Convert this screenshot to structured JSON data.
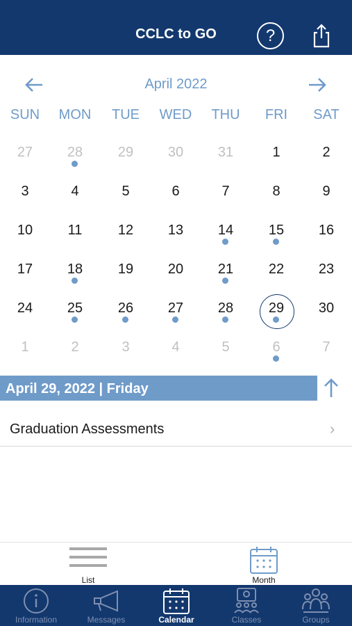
{
  "header": {
    "title": "CCLC to GO",
    "help_icon_glyph": "?"
  },
  "calendar": {
    "month_label": "April 2022",
    "weekdays": [
      "SUN",
      "MON",
      "TUE",
      "WED",
      "THU",
      "FRI",
      "SAT"
    ],
    "weeks": [
      [
        {
          "d": "27",
          "o": true,
          "e": false
        },
        {
          "d": "28",
          "o": true,
          "e": true
        },
        {
          "d": "29",
          "o": true,
          "e": false
        },
        {
          "d": "30",
          "o": true,
          "e": false
        },
        {
          "d": "31",
          "o": true,
          "e": false
        },
        {
          "d": "1",
          "o": false,
          "e": false
        },
        {
          "d": "2",
          "o": false,
          "e": false
        }
      ],
      [
        {
          "d": "3",
          "o": false,
          "e": false
        },
        {
          "d": "4",
          "o": false,
          "e": false
        },
        {
          "d": "5",
          "o": false,
          "e": false
        },
        {
          "d": "6",
          "o": false,
          "e": false
        },
        {
          "d": "7",
          "o": false,
          "e": false
        },
        {
          "d": "8",
          "o": false,
          "e": false
        },
        {
          "d": "9",
          "o": false,
          "e": false
        }
      ],
      [
        {
          "d": "10",
          "o": false,
          "e": false
        },
        {
          "d": "11",
          "o": false,
          "e": false
        },
        {
          "d": "12",
          "o": false,
          "e": false
        },
        {
          "d": "13",
          "o": false,
          "e": false
        },
        {
          "d": "14",
          "o": false,
          "e": true
        },
        {
          "d": "15",
          "o": false,
          "e": true
        },
        {
          "d": "16",
          "o": false,
          "e": false
        }
      ],
      [
        {
          "d": "17",
          "o": false,
          "e": false
        },
        {
          "d": "18",
          "o": false,
          "e": true
        },
        {
          "d": "19",
          "o": false,
          "e": false
        },
        {
          "d": "20",
          "o": false,
          "e": false
        },
        {
          "d": "21",
          "o": false,
          "e": true
        },
        {
          "d": "22",
          "o": false,
          "e": false
        },
        {
          "d": "23",
          "o": false,
          "e": false
        }
      ],
      [
        {
          "d": "24",
          "o": false,
          "e": false
        },
        {
          "d": "25",
          "o": false,
          "e": true
        },
        {
          "d": "26",
          "o": false,
          "e": true
        },
        {
          "d": "27",
          "o": false,
          "e": true
        },
        {
          "d": "28",
          "o": false,
          "e": true
        },
        {
          "d": "29",
          "o": false,
          "e": true,
          "s": true
        },
        {
          "d": "30",
          "o": false,
          "e": false
        }
      ],
      [
        {
          "d": "1",
          "o": true,
          "e": false
        },
        {
          "d": "2",
          "o": true,
          "e": false
        },
        {
          "d": "3",
          "o": true,
          "e": false
        },
        {
          "d": "4",
          "o": true,
          "e": false
        },
        {
          "d": "5",
          "o": true,
          "e": false
        },
        {
          "d": "6",
          "o": true,
          "e": true
        },
        {
          "d": "7",
          "o": true,
          "e": false
        }
      ]
    ]
  },
  "selected_day": {
    "label": "April 29, 2022 | Friday"
  },
  "events": [
    {
      "title": "Graduation Assessments",
      "chevron": "›"
    }
  ],
  "view_switch": {
    "list_label": "List",
    "month_label": "Month"
  },
  "tabs": [
    {
      "label": "Information",
      "icon": "info-icon",
      "active": false
    },
    {
      "label": "Messages",
      "icon": "megaphone-icon",
      "active": false
    },
    {
      "label": "Calendar",
      "icon": "calendar-icon",
      "active": true
    },
    {
      "label": "Classes",
      "icon": "classes-icon",
      "active": false
    },
    {
      "label": "Groups",
      "icon": "groups-icon",
      "active": false
    }
  ],
  "colors": {
    "brand_navy": "#13386e",
    "accent_blue": "#6f9bc9",
    "muted_day": "#c0c0c0",
    "inactive_tab": "#7f8fb0"
  }
}
